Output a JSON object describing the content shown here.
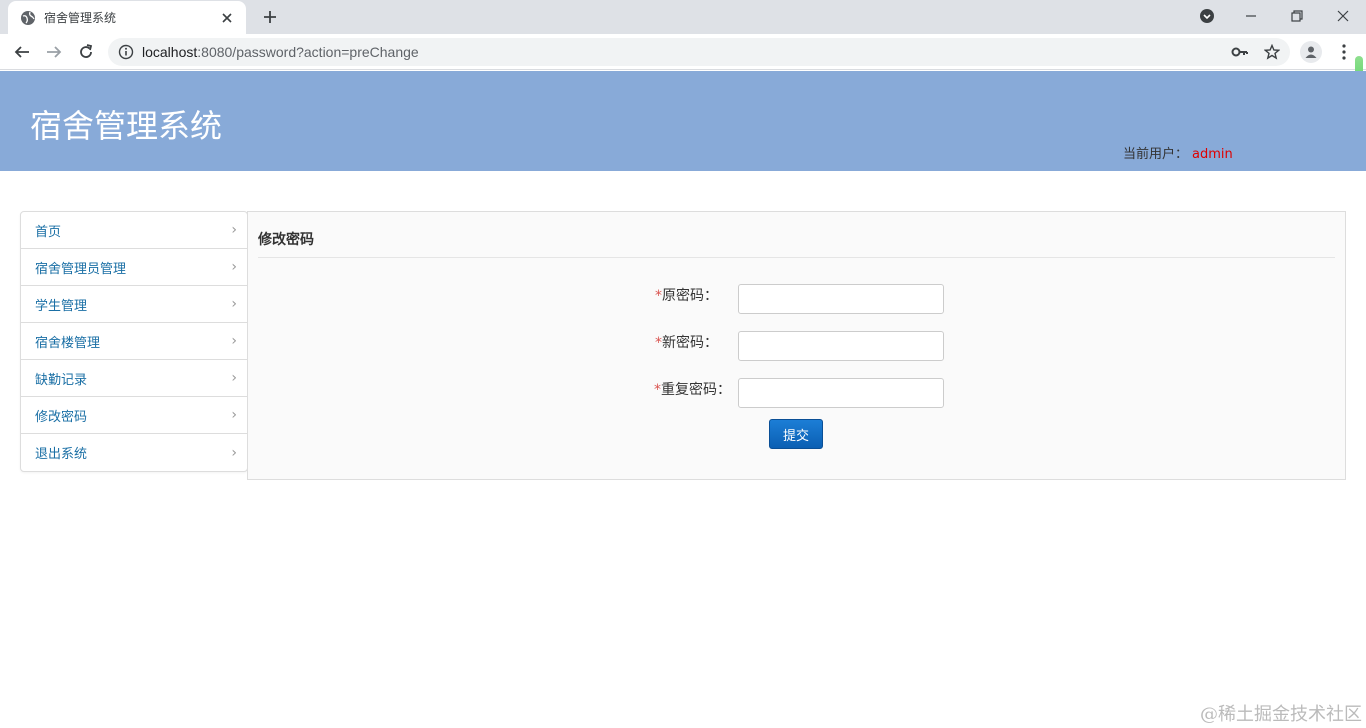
{
  "browser": {
    "tab_title": "宿舍管理系统",
    "url_host": "localhost",
    "url_rest": ":8080/password?action=preChange"
  },
  "header": {
    "site_title": "宿舍管理系统",
    "current_user_label": "当前用户：",
    "current_user": "admin"
  },
  "sidebar": {
    "items": [
      {
        "label": "首页"
      },
      {
        "label": "宿舍管理员管理"
      },
      {
        "label": "学生管理"
      },
      {
        "label": "宿舍楼管理"
      },
      {
        "label": "缺勤记录"
      },
      {
        "label": "修改密码"
      },
      {
        "label": "退出系统"
      }
    ]
  },
  "main": {
    "title": "修改密码",
    "form": {
      "required_mark": "*",
      "old_password_label": "原密码：",
      "new_password_label": "新密码：",
      "repeat_password_label": "重复密码：",
      "old_password_value": "",
      "new_password_value": "",
      "repeat_password_value": "",
      "submit_label": "提交"
    }
  },
  "watermark": "@稀土掘金技术社区",
  "colors": {
    "banner": "#88aad8",
    "link": "#1a6fa5",
    "username": "#e00000",
    "required": "#d9534f",
    "button": "#0b5fb3"
  }
}
